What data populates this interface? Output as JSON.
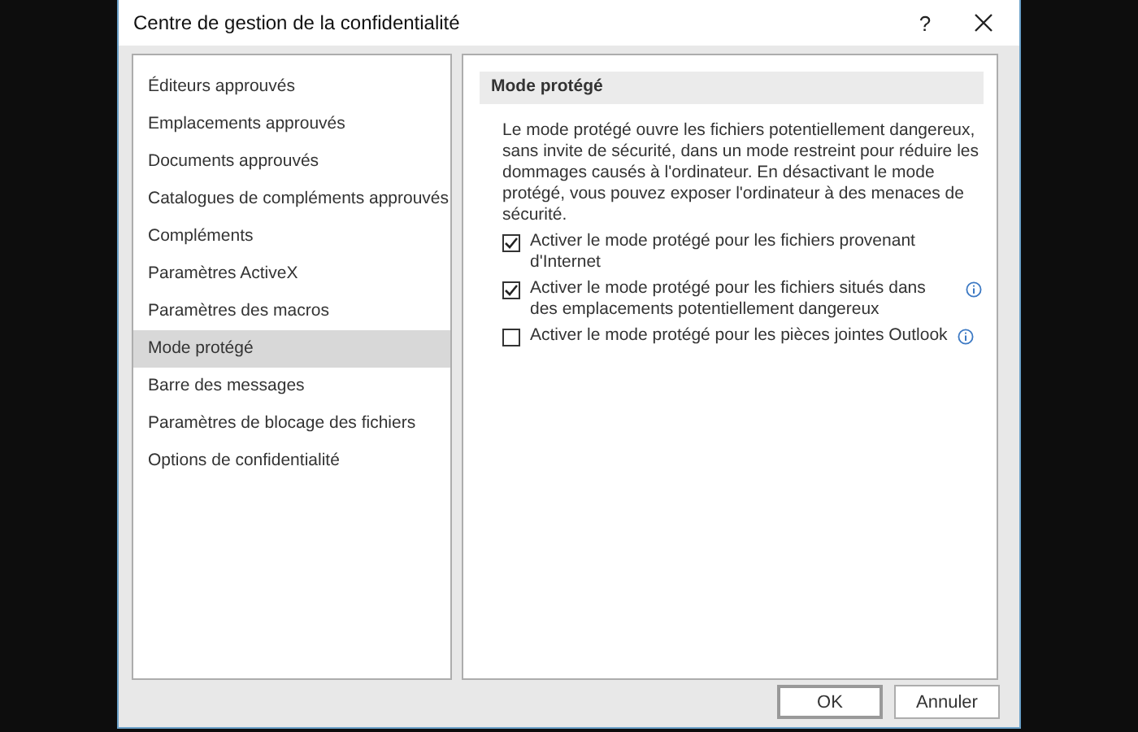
{
  "window": {
    "title": "Centre de gestion de la confidentialité",
    "help": "?"
  },
  "sidebar": {
    "items": [
      {
        "label": "Éditeurs approuvés",
        "selected": false
      },
      {
        "label": "Emplacements approuvés",
        "selected": false
      },
      {
        "label": "Documents approuvés",
        "selected": false
      },
      {
        "label": "Catalogues de compléments approuvés",
        "selected": false
      },
      {
        "label": "Compléments",
        "selected": false
      },
      {
        "label": "Paramètres ActiveX",
        "selected": false
      },
      {
        "label": "Paramètres des macros",
        "selected": false
      },
      {
        "label": "Mode protégé",
        "selected": true
      },
      {
        "label": "Barre des messages",
        "selected": false
      },
      {
        "label": "Paramètres de blocage des fichiers",
        "selected": false
      },
      {
        "label": "Options de confidentialité",
        "selected": false
      }
    ]
  },
  "panel": {
    "heading": "Mode protégé",
    "description": "Le mode protégé ouvre les fichiers potentiellement dangereux, sans invite de sécurité, dans un mode restreint pour réduire les dommages causés à l'ordinateur. En désactivant le mode protégé, vous pouvez exposer l'ordinateur à des menaces de sécurité.",
    "options": [
      {
        "label": "Activer le mode protégé pour les fichiers provenant d'Internet",
        "checked": true,
        "info": false
      },
      {
        "label": "Activer le mode protégé pour les fichiers situés dans des emplacements potentiellement dangereux",
        "checked": true,
        "info": true
      },
      {
        "label": "Activer le mode protégé pour les pièces jointes Outlook",
        "checked": false,
        "info": true
      }
    ]
  },
  "buttons": [
    "OK",
    "Annuler"
  ]
}
